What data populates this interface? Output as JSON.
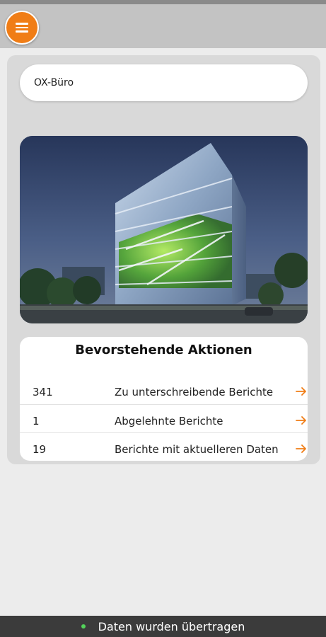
{
  "app_bar": {
    "menu_icon": "hamburger-menu-icon",
    "accent": "#f07d16"
  },
  "office": {
    "selected": "OX-Büro"
  },
  "actions": {
    "title": "Bevorstehende Aktionen",
    "rows": [
      {
        "count": "341",
        "label": "Zu unterschreibende Berichte",
        "icon": "arrow-right-icon"
      },
      {
        "count": "1",
        "label": "Abgelehnte Berichte",
        "icon": "arrow-right-icon"
      },
      {
        "count": "19",
        "label": "Berichte mit aktuelleren Daten",
        "icon": "arrow-right-icon"
      }
    ]
  },
  "status": {
    "text": "Daten wurden übertragen",
    "dot_color": "#53d35a"
  }
}
